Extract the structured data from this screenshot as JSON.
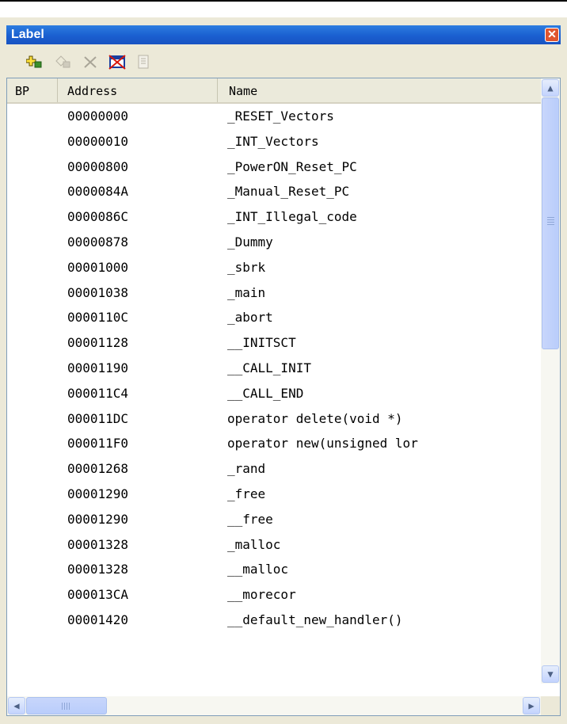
{
  "window": {
    "title": "Label",
    "close_glyph": "✕"
  },
  "toolbar": {
    "buttons": [
      {
        "icon": "add-label-icon",
        "enabled": true
      },
      {
        "icon": "edit-label-icon",
        "enabled": false
      },
      {
        "icon": "delete-label-icon",
        "enabled": false
      },
      {
        "icon": "delete-all-labels-icon",
        "enabled": true
      },
      {
        "icon": "properties-icon",
        "enabled": false
      }
    ]
  },
  "table": {
    "columns": {
      "bp": "BP",
      "address": "Address",
      "name": "Name"
    },
    "rows": [
      {
        "address": "00000000",
        "name": "_RESET_Vectors"
      },
      {
        "address": "00000010",
        "name": "_INT_Vectors"
      },
      {
        "address": "00000800",
        "name": "_PowerON_Reset_PC"
      },
      {
        "address": "0000084A",
        "name": "_Manual_Reset_PC"
      },
      {
        "address": "0000086C",
        "name": "_INT_Illegal_code"
      },
      {
        "address": "00000878",
        "name": "_Dummy"
      },
      {
        "address": "00001000",
        "name": "_sbrk"
      },
      {
        "address": "00001038",
        "name": "_main"
      },
      {
        "address": "0000110C",
        "name": "_abort"
      },
      {
        "address": "00001128",
        "name": "__INITSCT"
      },
      {
        "address": "00001190",
        "name": "__CALL_INIT"
      },
      {
        "address": "000011C4",
        "name": "__CALL_END"
      },
      {
        "address": "000011DC",
        "name": "operator delete(void *)"
      },
      {
        "address": "000011F0",
        "name": "operator new(unsigned lor"
      },
      {
        "address": "00001268",
        "name": "_rand"
      },
      {
        "address": "00001290",
        "name": "_free"
      },
      {
        "address": "00001290",
        "name": "__free"
      },
      {
        "address": "00001328",
        "name": "_malloc"
      },
      {
        "address": "00001328",
        "name": "__malloc"
      },
      {
        "address": "000013CA",
        "name": "__morecor"
      },
      {
        "address": "00001420",
        "name": "__default_new_handler()"
      }
    ]
  },
  "scrollbars": {
    "vertical": "visible",
    "horizontal": "visible"
  }
}
